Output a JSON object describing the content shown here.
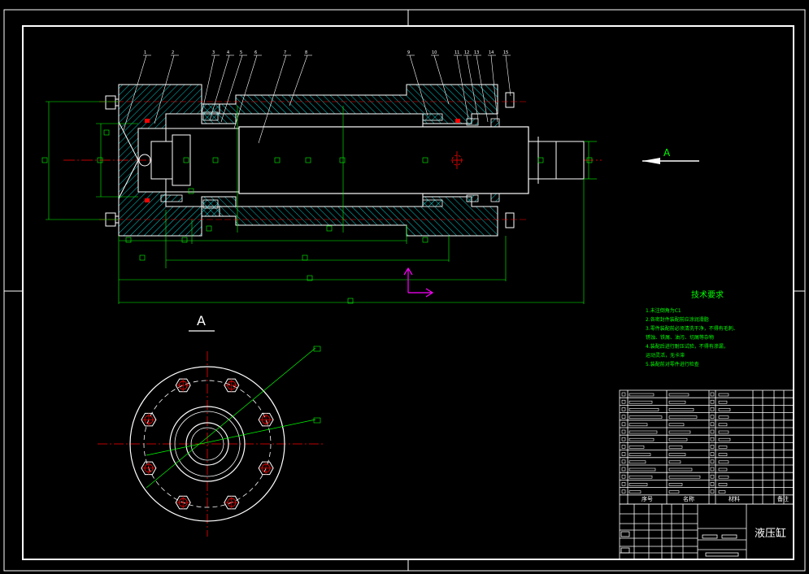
{
  "drawing": {
    "section_label": "A",
    "view_label": "A",
    "balloon_numbers": [
      "1",
      "2",
      "3",
      "4",
      "5",
      "6",
      "7",
      "8",
      "9",
      "10",
      "11",
      "12",
      "13",
      "14",
      "15"
    ],
    "tech_req_title": "技术要求",
    "tech_req_lines": [
      "1.未注倒角为C1",
      "2.各密封件装配前应涂润滑脂",
      "3.零件装配前必须清洗干净，不得有毛刺、",
      "   锈蚀、铁屑、油污、切屑等杂物",
      "4.装配后进行耐压试验，不得有渗漏，",
      "   运动灵活，无卡滞",
      "5.装配前对零件进行检查"
    ],
    "parts_header": [
      "序号",
      "名称",
      "材料",
      "备注"
    ],
    "title_name": "液压缸"
  },
  "colors": {
    "background": "#000000",
    "frame": "#ffffff",
    "dimension": "#00ff00",
    "centerline": "#ff0000",
    "leader": "#ffffff",
    "hatch": "#00ffff",
    "ucs": "#ff00ff",
    "text": "#ffff00"
  }
}
